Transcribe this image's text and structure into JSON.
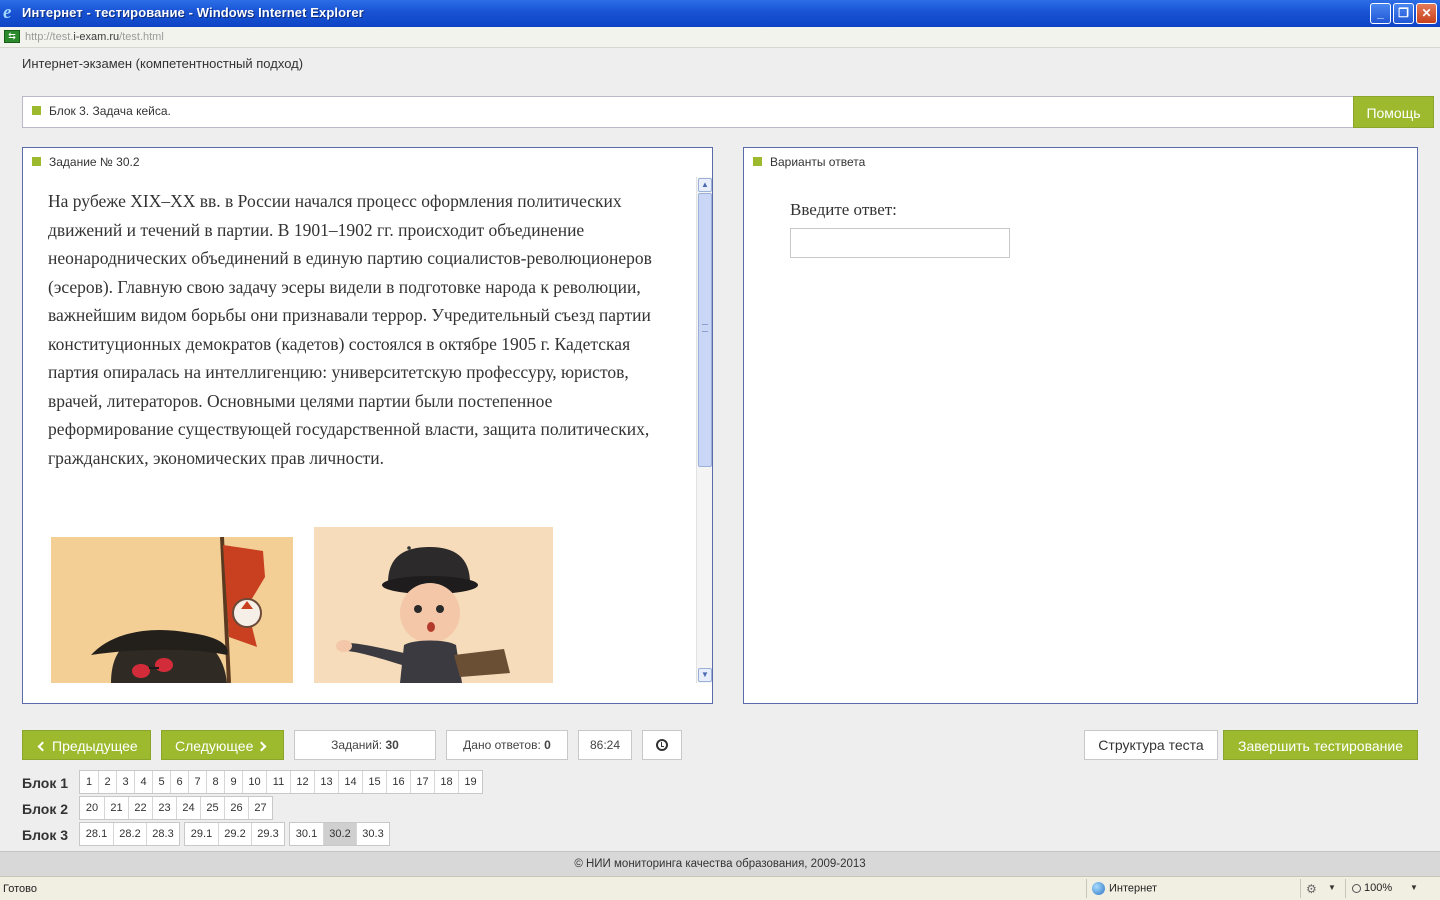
{
  "window": {
    "title": "Интернет - тестирование - Windows Internet Explorer",
    "url_prefix": "http://test.",
    "url_domain": "i-exam.ru",
    "url_path": "/test.html",
    "minimize": "_",
    "restore": "❐",
    "close": "✕"
  },
  "page": {
    "exam_title": "Интернет-экзамен (компетентностный подход)",
    "block_label": "Блок 3. Задача кейса.",
    "help_label": "Помощь"
  },
  "task": {
    "header": "Задание № 30.2",
    "text": "На рубеже XIX–XX вв. в России начался процесс оформления политических движений и течений в партии. В 1901–1902 гг. происходит объединение неонароднических объединений в единую партию социалистов-революционеров (эсеров). Главную свою задачу эсеры видели в подготовке народа к революции, важнейшим видом борьбы они признавали террор. Учредительный съезд партии конституционных демократов (кадетов) состоялся в октябре 1905 г. Кадетская партия опиралась на интеллигенцию: университетскую профессуру, юристов, врачей, литераторов. Основными целями партии были постепенное реформирование существующей государственной власти, защита политических, гражданских, экономических прав личности."
  },
  "answer": {
    "header": "Варианты ответа",
    "prompt": "Введите ответ:",
    "value": ""
  },
  "controls": {
    "prev_label": "Предыдущее",
    "next_label": "Следующее",
    "tasks_label": "Заданий:",
    "tasks_count": "30",
    "given_label": "Дано ответов:",
    "given_count": "0",
    "timer": "86:24",
    "structure_label": "Структура теста",
    "finish_label": "Завершить тестирование"
  },
  "blocks": [
    {
      "name": "Блок 1",
      "groups": [
        [
          "1",
          "2",
          "3",
          "4",
          "5",
          "6",
          "7",
          "8",
          "9",
          "10",
          "11",
          "12",
          "13",
          "14",
          "15",
          "16",
          "17",
          "18",
          "19"
        ]
      ]
    },
    {
      "name": "Блок 2",
      "groups": [
        [
          "20",
          "21",
          "22",
          "23",
          "24",
          "25",
          "26",
          "27"
        ]
      ]
    },
    {
      "name": "Блок 3",
      "groups": [
        [
          "28.1",
          "28.2",
          "28.3"
        ],
        [
          "29.1",
          "29.2",
          "29.3"
        ],
        [
          "30.1",
          "30.2",
          "30.3"
        ]
      ]
    }
  ],
  "selected_task": "30.2",
  "footer": "© НИИ мониторинга качества образования, 2009-2013",
  "status": {
    "left": "Готово",
    "zone": "Интернет",
    "zoom": "100%"
  },
  "colors": {
    "accent": "#9dba2f",
    "panel_border": "#5b6aa8",
    "titlebar": "#1a55d6"
  }
}
